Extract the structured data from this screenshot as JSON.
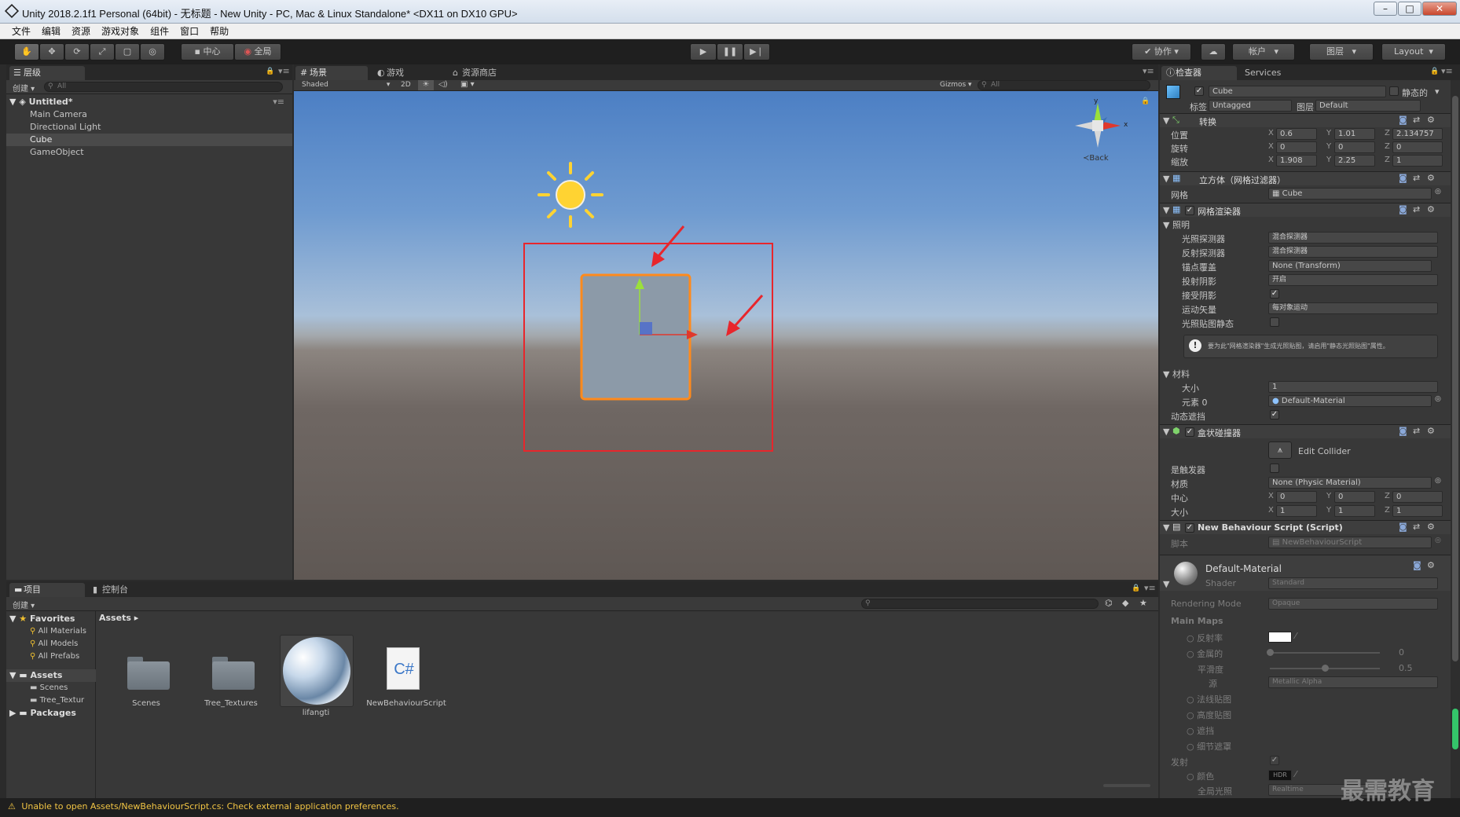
{
  "window": {
    "title": "Unity 2018.2.1f1 Personal (64bit) - 无标题 - New Unity - PC, Mac & Linux Standalone* <DX11 on DX10 GPU>",
    "min": "–",
    "max": "□",
    "close": "✕"
  },
  "menu": [
    "文件",
    "编辑",
    "资源",
    "游戏对象",
    "组件",
    "窗口",
    "帮助"
  ],
  "toolbar": {
    "pivot": "中心",
    "space": "全局",
    "collab": "协作",
    "account": "帐户",
    "layers": "图层",
    "layout": "Layout",
    "play": "▶",
    "pause": "❚❚",
    "step": "▶❘"
  },
  "hierarchy": {
    "tab": "层级",
    "create": "创建",
    "search_placeholder": "All",
    "scene": "Untitled*",
    "items": [
      "Main Camera",
      "Directional Light",
      "Cube",
      "GameObject"
    ],
    "selected": "Cube"
  },
  "scene": {
    "tabs": [
      "场景",
      "游戏",
      "资源商店"
    ],
    "shading": "Shaded",
    "mode_2d": "2D",
    "gizmos": "Gizmos",
    "search_placeholder": "All",
    "gizmo_back": "Back",
    "axis_x": "x",
    "axis_y": "y"
  },
  "inspector": {
    "tabs": [
      "检查器",
      "Services"
    ],
    "object_name": "Cube",
    "static": "静态的",
    "tag_label": "标签",
    "tag": "Untagged",
    "layer_label": "图层",
    "layer": "Default",
    "transform": {
      "title": "转换",
      "position_label": "位置",
      "rotation_label": "旋转",
      "scale_label": "缩放",
      "position": [
        "0.6",
        "1.01",
        "2.134757"
      ],
      "rotation": [
        "0",
        "0",
        "0"
      ],
      "scale": [
        "1.908",
        "2.25",
        "1"
      ]
    },
    "mesh_filter": {
      "title": "立方体（网格过滤器）",
      "mesh_label": "网格",
      "mesh": "Cube"
    },
    "mesh_renderer": {
      "title": "网格渲染器",
      "lighting": "照明",
      "light_probes_label": "光照探测器",
      "light_probes": "混合探测器",
      "reflection_probes_label": "反射探测器",
      "reflection_probes": "混合探测器",
      "anchor_label": "锚点覆盖",
      "anchor": "None (Transform)",
      "cast_shadows_label": "投射阴影",
      "cast_shadows": "开启",
      "receive_shadows_label": "接受阴影",
      "motion_vectors_label": "运动矢量",
      "motion_vectors": "每对象运动",
      "lightmap_static_label": "光照贴图静态",
      "info": "要为此\"网格渲染器\"生成光照贴图，请启用\"静态光照贴图\"属性。",
      "materials": "材料",
      "size_label": "大小",
      "size": "1",
      "element0_label": "元素 0",
      "element0": "Default-Material",
      "dynamic_occluded_label": "动态遮挡"
    },
    "box_collider": {
      "title": "盒状碰撞器",
      "edit_collider": "Edit Collider",
      "is_trigger_label": "是触发器",
      "material_label": "材质",
      "material": "None (Physic Material)",
      "center_label": "中心",
      "center": [
        "0",
        "0",
        "0"
      ],
      "size_label": "大小",
      "size": [
        "1",
        "1",
        "1"
      ]
    },
    "script": {
      "title": "New Behaviour Script (Script)",
      "script_label": "脚本",
      "script": "NewBehaviourScript"
    },
    "material": {
      "name": "Default-Material",
      "shader_label": "Shader",
      "shader": "Standard",
      "rendering_mode_label": "Rendering Mode",
      "rendering_mode": "Opaque",
      "main_maps": "Main Maps",
      "albedo": "反射率",
      "metallic": "金属的",
      "metallic_value": "0",
      "smoothness": "平滑度",
      "smoothness_value": "0.5",
      "source_label": "源",
      "source": "Metallic Alpha",
      "normal_map": "法线贴图",
      "height_map": "高度贴图",
      "occlusion": "遮挡",
      "detail_mask": "细节遮罩",
      "emission": "发射",
      "color": "颜色",
      "hdr": "HDR",
      "gi": "全局光照",
      "gi_value": "Realtime"
    }
  },
  "project": {
    "tabs": [
      "项目",
      "控制台"
    ],
    "create": "创建",
    "favorites": "Favorites",
    "fav_items": [
      "All Materials",
      "All Models",
      "All Prefabs"
    ],
    "assets": "Assets",
    "asset_folders": [
      "Scenes",
      "Tree_Textur"
    ],
    "packages": "Packages",
    "breadcrumb": "Assets",
    "grid": [
      "Scenes",
      "Tree_Textures",
      "lifangti",
      "NewBehaviourScript"
    ],
    "script_glyph": "C#"
  },
  "status": "Unable to open Assets/NewBehaviourScript.cs: Check external application preferences.",
  "watermark": "最需教育",
  "colors": {
    "selection": "#ff8a1c",
    "annotation": "#e8262c",
    "accent": "#3c6fb3"
  }
}
